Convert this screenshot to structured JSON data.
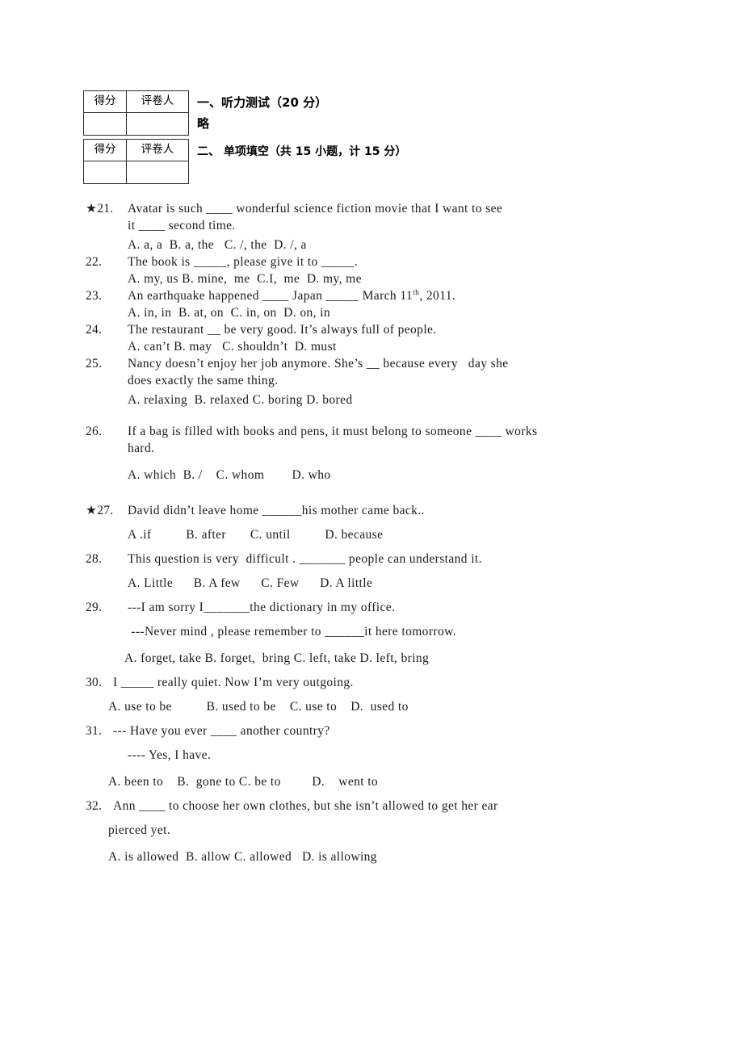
{
  "score_table": {
    "col1_header": "得分",
    "col2_header": "评卷人",
    "blank_value": ""
  },
  "sections": [
    {
      "title": "一、听力测试（20 分）",
      "note": "略"
    },
    {
      "title": "二、      单项填空（共 15 小题，计 15 分）",
      "note": ""
    }
  ],
  "questions": [
    {
      "marker": "★21.",
      "stem": "Avatar is such ____ wonderful science fiction movie that I want to see",
      "stem_cont": "it ____ second time.",
      "options": "A. a, a  B. a, the   C. /, the  D. /, a"
    },
    {
      "marker": "22.",
      "stem": "The book is _____, please give it to _____.",
      "options": "A. my, us B. mine,  me  C.I,  me  D. my, me"
    },
    {
      "marker": "23.",
      "stem_pre": "An earthquake happened ____ Japan _____ March 11",
      "stem_sup": "th",
      "stem_post": ", 2011.",
      "options": "A. in, in  B. at, on  C. in, on  D. on, in"
    },
    {
      "marker": "24.",
      "stem": "The restaurant __ be very good. It’s always full of people.",
      "options": "A. can’t B. may   C. shouldn’t  D. must"
    },
    {
      "marker": "25.",
      "stem": "Nancy doesn’t enjoy her job anymore. She’s __ because every   day she",
      "stem_cont": "does exactly the same thing.",
      "options": "A. relaxing  B. relaxed C. boring D. bored"
    },
    {
      "marker": "26.",
      "stem": "If a bag is filled with books and pens, it must belong to someone ____ works",
      "stem_cont": "hard.",
      "options": "A. which  B. /    C. whom        D. who"
    },
    {
      "marker": "★27.",
      "stem": "David didn’t leave home ______his mother came back..",
      "options": "A .if          B. after       C. until          D. because"
    },
    {
      "marker": "28.",
      "stem": "This question is very  difficult . _______ people can understand it.",
      "options": "A. Little      B. A few      C. Few      D. A little"
    },
    {
      "marker": "29.",
      "stem": "---I am sorry I_______the dictionary in my office.",
      "stem_cont": " ---Never mind , please remember to ______it here tomorrow.",
      "options": "A. forget, take B. forget,  bring C. left, take D. left, bring"
    },
    {
      "marker": "30.",
      "stem": "I _____ really quiet. Now I’m very outgoing.",
      "options": "A. use to be          B. used to be    C. use to    D.  used to"
    },
    {
      "marker": "31.",
      "stem": "--- Have you ever ____ another country?",
      "stem_cont": "---- Yes, I have.",
      "options": "A. been to    B.  gone to C. be to         D.    went to"
    },
    {
      "marker": "32.",
      "stem": "Ann ____ to choose her own clothes, but she isn’t allowed to get her ear",
      "stem_cont": "pierced yet.",
      "options": "A. is allowed  B. allow C. allowed   D. is allowing"
    }
  ]
}
